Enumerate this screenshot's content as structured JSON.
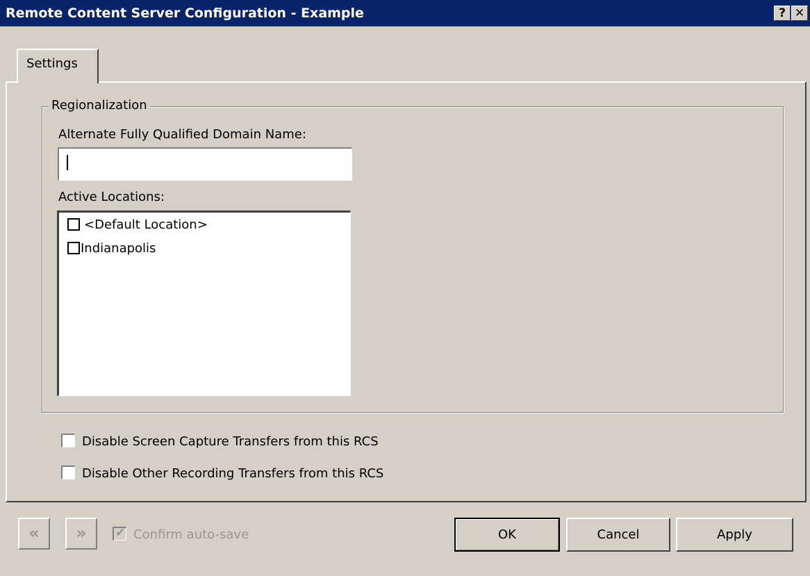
{
  "window": {
    "title": "Remote Content Server Configuration - Example",
    "help_label": "?",
    "close_label": "✕"
  },
  "tabs": [
    {
      "label": "Settings",
      "selected": true
    }
  ],
  "regionalization": {
    "group_title": "Regionalization",
    "fqdn_label": "Alternate Fully Qualified Domain Name:",
    "fqdn_value": "",
    "locations_label": "Active Locations:",
    "locations": [
      {
        "label": "<Default Location>",
        "checked": false
      },
      {
        "label": "Indianapolis",
        "checked": false
      }
    ]
  },
  "options": [
    {
      "label": "Disable Screen Capture Transfers from this RCS",
      "checked": false
    },
    {
      "label": "Disable Other Recording Transfers from this RCS",
      "checked": false
    }
  ],
  "footer": {
    "prev_icon": "«",
    "next_icon": "»",
    "confirm_autosave_label": "Confirm auto-save",
    "confirm_autosave_checked": true,
    "ok_label": "OK",
    "cancel_label": "Cancel",
    "apply_label": "Apply"
  },
  "colors": {
    "titlebar": "#0a246a",
    "face": "#d4d0c8"
  }
}
